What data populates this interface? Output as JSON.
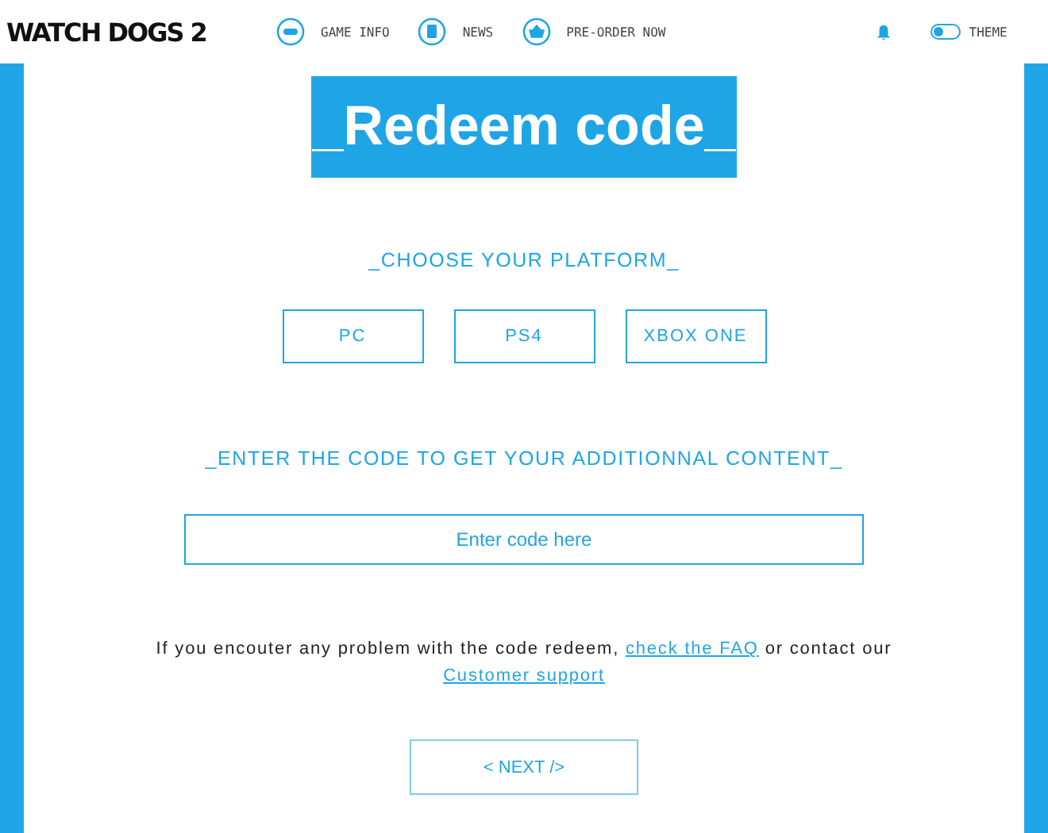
{
  "header": {
    "logo": "WATCH DOGS 2",
    "nav": [
      {
        "label": "GAME INFO",
        "kind": "game"
      },
      {
        "label": "NEWS",
        "kind": "news"
      },
      {
        "label": "PRE-ORDER NOW",
        "kind": "shop"
      }
    ],
    "theme": {
      "label": "THEME",
      "on": false
    }
  },
  "title": "_Redeem code_",
  "platform_heading": "_CHOOSE YOUR PLATFORM_",
  "platforms": [
    {
      "label": "PC",
      "selected": false
    },
    {
      "label": "PS4",
      "selected": false
    },
    {
      "label": "XBOX ONE",
      "selected": false
    }
  ],
  "code_heading": "_ENTER THE CODE TO GET YOUR ADDITIONNAL CONTENT_",
  "code_field": {
    "placeholder": "Enter code here"
  },
  "help": {
    "before": "If you encouter any problem with the code redeem, ",
    "faq_link": "check the FAQ",
    "middle": " or contact our ",
    "support_link": "Customer support"
  },
  "next_button": "< NEXT />"
}
